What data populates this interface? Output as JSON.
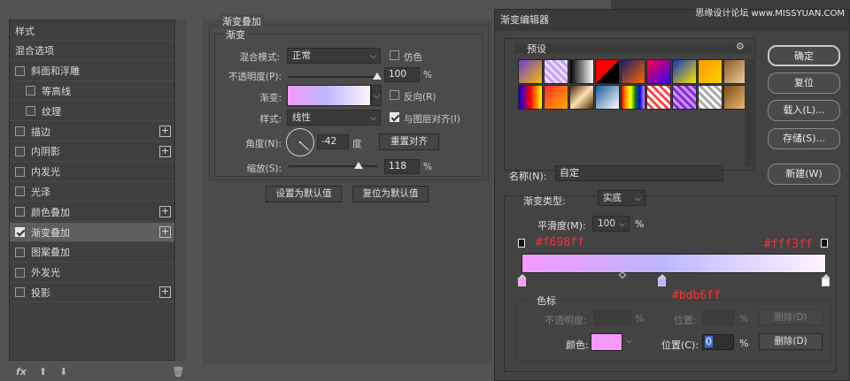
{
  "left_list": {
    "items": [
      {
        "label": "样式",
        "checkbox": false,
        "checked": false,
        "plus": false,
        "selected": false,
        "indent": 0
      },
      {
        "label": "混合选项",
        "checkbox": false,
        "checked": false,
        "plus": false,
        "selected": false,
        "indent": 0
      },
      {
        "label": "斜面和浮雕",
        "checkbox": true,
        "checked": false,
        "plus": false,
        "selected": false,
        "indent": 0
      },
      {
        "label": "等高线",
        "checkbox": true,
        "checked": false,
        "plus": false,
        "selected": false,
        "indent": 1
      },
      {
        "label": "纹理",
        "checkbox": true,
        "checked": false,
        "plus": false,
        "selected": false,
        "indent": 1
      },
      {
        "label": "描边",
        "checkbox": true,
        "checked": false,
        "plus": true,
        "selected": false,
        "indent": 0
      },
      {
        "label": "内阴影",
        "checkbox": true,
        "checked": false,
        "plus": true,
        "selected": false,
        "indent": 0
      },
      {
        "label": "内发光",
        "checkbox": true,
        "checked": false,
        "plus": false,
        "selected": false,
        "indent": 0
      },
      {
        "label": "光泽",
        "checkbox": true,
        "checked": false,
        "plus": false,
        "selected": false,
        "indent": 0
      },
      {
        "label": "颜色叠加",
        "checkbox": true,
        "checked": false,
        "plus": true,
        "selected": false,
        "indent": 0
      },
      {
        "label": "渐变叠加",
        "checkbox": true,
        "checked": true,
        "plus": true,
        "selected": true,
        "indent": 0
      },
      {
        "label": "图案叠加",
        "checkbox": true,
        "checked": false,
        "plus": false,
        "selected": false,
        "indent": 0
      },
      {
        "label": "外发光",
        "checkbox": true,
        "checked": false,
        "plus": false,
        "selected": false,
        "indent": 0
      },
      {
        "label": "投影",
        "checkbox": true,
        "checked": false,
        "plus": true,
        "selected": false,
        "indent": 0
      }
    ],
    "bottom": {
      "fx": "fx",
      "up": "⬆",
      "down": "⬇",
      "trash": "🗑"
    }
  },
  "gradient_overlay": {
    "section_title": "渐变叠加",
    "group_title": "渐变",
    "blend_mode_label": "混合模式:",
    "blend_mode_value": "正常",
    "dither_label": "仿色",
    "opacity_label": "不透明度(P):",
    "opacity_value": "100",
    "opacity_fraction": 1.0,
    "percent": "%",
    "gradient_label": "渐变:",
    "reverse_label": "反向(R)",
    "style_label": "样式:",
    "style_value": "线性",
    "align_label": "与图层对齐(I)",
    "align_checked": true,
    "angle_label": "角度(N):",
    "angle_value": "-42",
    "degree": "度",
    "reset_align": "重置对齐",
    "scale_label": "缩放(S):",
    "scale_value": "118",
    "scale_fraction": 0.79,
    "set_default": "设置为默认值",
    "reset_default": "复位为默认值"
  },
  "gradient_editor": {
    "title": "渐变编辑器",
    "presets_label": "预设",
    "gear": "⚙",
    "buttons": {
      "ok": "确定",
      "reset": "复位",
      "load": "载入(L)...",
      "save": "存储(S)...",
      "new": "新建(W)"
    },
    "name_label": "名称(N):",
    "name_value": "自定",
    "type_label": "渐变类型:",
    "type_value": "实底",
    "smooth_label": "平滑度(M):",
    "smooth_value": "100",
    "percent": "%",
    "annotation_left": "#f698ff",
    "annotation_right": "#fff3ff",
    "annotation_mid": "#bdb6ff",
    "stops_label": "色标",
    "opacity_label": "不透明度:",
    "position_label": "位置:",
    "delete_label": "删除(D)",
    "color_label": "颜色:",
    "position_c_label": "位置(C):",
    "position_c_value": "0",
    "color_start": "#f698ff",
    "color_mid": "#bdb6ff",
    "color_end": "#fff3ff",
    "mid_position": 0.46,
    "midpoint_position": 0.33
  },
  "watermark": "思缘设计论坛 www.MISSYUAN.COM"
}
